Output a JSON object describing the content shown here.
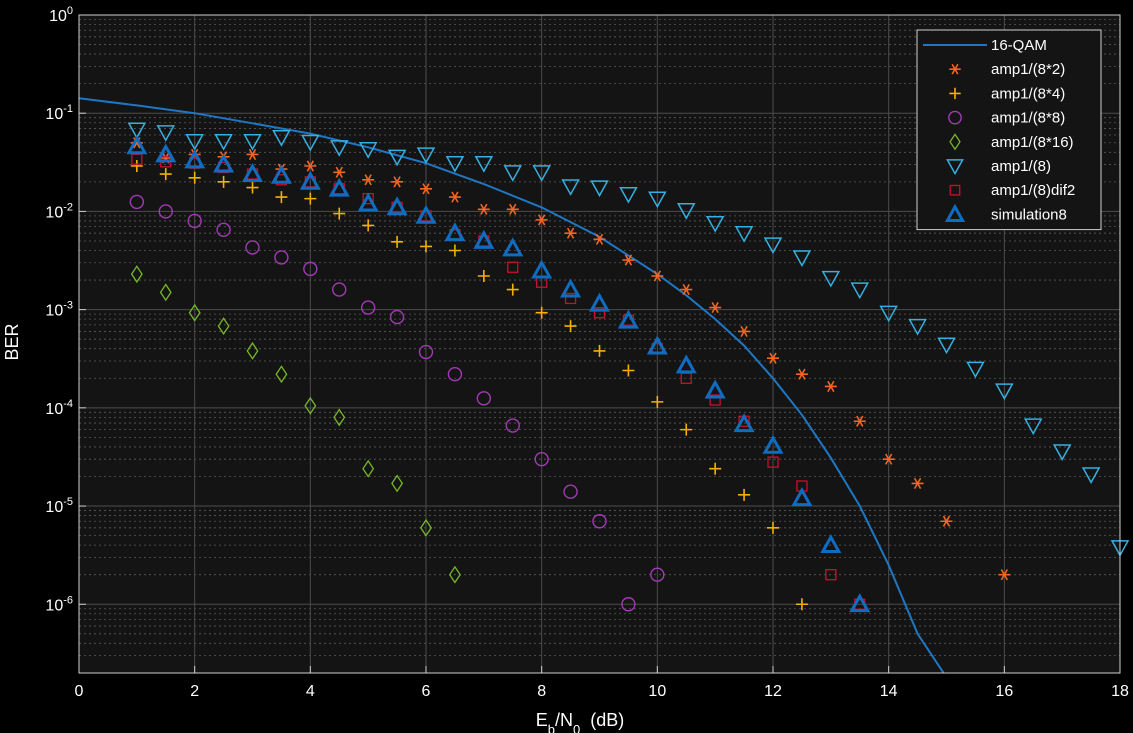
{
  "chart_data": {
    "type": "scatter",
    "xlabel": {
      "base": "E",
      "sub1": "b",
      "mid": "/N",
      "sub2": "0",
      "unit": "  (dB)"
    },
    "ylabel": "BER",
    "xlim": [
      0,
      18
    ],
    "ylim_log10": [
      -6.7,
      0
    ],
    "yscale": "log",
    "grid": true,
    "minor_grid": true,
    "legend_position": "top-right",
    "x_ticks": [
      0,
      2,
      4,
      6,
      8,
      10,
      12,
      14,
      16,
      18
    ],
    "y_ticks": [
      {
        "base": "10",
        "exp": "0",
        "value": 1
      },
      {
        "base": "10",
        "exp": "-1",
        "value": 0.1
      },
      {
        "base": "10",
        "exp": "-2",
        "value": 0.01
      },
      {
        "base": "10",
        "exp": "-3",
        "value": 0.001
      },
      {
        "base": "10",
        "exp": "-4",
        "value": 0.0001
      },
      {
        "base": "10",
        "exp": "-5",
        "value": 1e-05
      },
      {
        "base": "10",
        "exp": "-6",
        "value": 1e-06
      }
    ],
    "series": [
      {
        "name": "16-QAM",
        "style": "line",
        "color": "#1f77c4",
        "x": [
          0,
          1,
          2,
          3,
          4,
          5,
          6,
          7,
          8,
          9,
          10,
          10.5,
          11,
          11.5,
          12,
          12.5,
          13,
          13.5,
          14,
          14.5,
          15
        ],
        "y": [
          0.142,
          0.12,
          0.1,
          0.079,
          0.062,
          0.045,
          0.031,
          0.019,
          0.011,
          0.0055,
          0.0023,
          0.0014,
          0.0008,
          0.00043,
          0.0002,
          8.5e-05,
          3.1e-05,
          1e-05,
          2.5e-06,
          5e-07,
          1.8e-07
        ]
      },
      {
        "name": "amp1/(8*2)",
        "style": "marker",
        "marker": "asterisk",
        "color": "#f26522",
        "x": [
          1,
          1.5,
          2,
          2.5,
          3,
          3.5,
          4,
          4.5,
          5,
          5.5,
          6,
          6.5,
          7,
          7.5,
          8,
          8.5,
          9,
          9.5,
          10,
          10.5,
          11,
          11.5,
          12,
          12.5,
          13,
          13.5,
          14,
          14.5,
          15,
          16
        ],
        "y": [
          0.05,
          0.035,
          0.038,
          0.036,
          0.038,
          0.027,
          0.029,
          0.025,
          0.021,
          0.02,
          0.017,
          0.014,
          0.0105,
          0.0105,
          0.0082,
          0.006,
          0.0052,
          0.0032,
          0.0022,
          0.0016,
          0.00105,
          0.0006,
          0.00032,
          0.00022,
          0.000165,
          7.3e-05,
          3e-05,
          1.7e-05,
          7e-06,
          2e-06
        ]
      },
      {
        "name": "amp1/(8*4)",
        "style": "marker",
        "marker": "plus",
        "color": "#f5b000",
        "x": [
          1,
          1.5,
          2,
          2.5,
          3,
          3.5,
          4,
          4.5,
          5,
          5.5,
          6,
          6.5,
          7,
          7.5,
          8,
          8.5,
          9,
          9.5,
          10,
          10.5,
          11,
          11.5,
          12,
          12.5
        ],
        "y": [
          0.029,
          0.024,
          0.022,
          0.02,
          0.0175,
          0.014,
          0.0135,
          0.0095,
          0.0072,
          0.0049,
          0.0044,
          0.004,
          0.0022,
          0.0016,
          0.00093,
          0.00068,
          0.00038,
          0.00024,
          0.000115,
          6e-05,
          2.4e-05,
          1.3e-05,
          6e-06,
          1e-06
        ]
      },
      {
        "name": "amp1/(8*8)",
        "style": "marker",
        "marker": "circle",
        "color": "#a23ab5",
        "x": [
          1,
          1.5,
          2,
          2.5,
          3,
          3.5,
          4,
          4.5,
          5,
          5.5,
          6,
          6.5,
          7,
          7.5,
          8,
          8.5,
          9,
          9.5,
          10
        ],
        "y": [
          0.0125,
          0.01,
          0.008,
          0.0065,
          0.0043,
          0.0034,
          0.0026,
          0.0016,
          0.00105,
          0.00084,
          0.00037,
          0.00022,
          0.000125,
          6.6e-05,
          3e-05,
          1.4e-05,
          7e-06,
          1e-06,
          2e-06
        ]
      },
      {
        "name": "amp1/(8*16)",
        "style": "marker",
        "marker": "diamond",
        "color": "#76b82a",
        "x": [
          1,
          1.5,
          2,
          2.5,
          3,
          3.5,
          4,
          4.5,
          5,
          5.5,
          6,
          6.5
        ],
        "y": [
          0.0023,
          0.0015,
          0.00093,
          0.00068,
          0.00038,
          0.00022,
          0.000105,
          8e-05,
          2.4e-05,
          1.7e-05,
          6e-06,
          2e-06
        ]
      },
      {
        "name": "amp1/(8)",
        "style": "marker",
        "marker": "triangle-down",
        "color": "#35b0e0",
        "x": [
          1,
          1.5,
          2,
          2.5,
          3,
          3.5,
          4,
          4.5,
          5,
          5.5,
          6,
          6.5,
          7,
          7.5,
          8,
          8.5,
          9,
          9.5,
          10,
          10.5,
          11,
          11.5,
          12,
          12.5,
          13,
          13.5,
          14,
          14.5,
          15,
          15.5,
          16,
          16.5,
          17,
          17.5,
          18
        ],
        "y": [
          0.068,
          0.064,
          0.052,
          0.052,
          0.052,
          0.057,
          0.051,
          0.045,
          0.043,
          0.036,
          0.038,
          0.031,
          0.031,
          0.025,
          0.025,
          0.018,
          0.0175,
          0.015,
          0.0135,
          0.0103,
          0.0076,
          0.006,
          0.0046,
          0.0034,
          0.0021,
          0.0016,
          0.00093,
          0.00068,
          0.00044,
          0.00025,
          0.00015,
          6.6e-05,
          3.6e-05,
          2.1e-05,
          3.8e-06
        ]
      },
      {
        "name": "amp1/(8)dif2",
        "style": "marker",
        "marker": "square",
        "color": "#c8102e",
        "x": [
          1,
          1.5,
          2,
          2.5,
          3,
          3.5,
          4,
          4.5,
          5,
          5.5,
          6,
          6.5,
          7,
          7.5,
          8,
          8.5,
          9,
          9.5,
          10,
          10.5,
          11,
          11.5,
          12,
          12.5,
          13,
          13.5
        ],
        "y": [
          0.034,
          0.032,
          0.031,
          0.028,
          0.024,
          0.021,
          0.02,
          0.017,
          0.0135,
          0.011,
          0.009,
          0.0058,
          0.005,
          0.0027,
          0.0019,
          0.0013,
          0.00093,
          0.00078,
          0.0004,
          0.0002,
          0.00012,
          7.3e-05,
          2.8e-05,
          1.6e-05,
          2e-06,
          1e-06
        ]
      },
      {
        "name": "simulation8",
        "style": "marker",
        "marker": "triangle-up",
        "color": "#0f6cc0",
        "x": [
          1,
          1.5,
          2,
          2.5,
          3,
          3.5,
          4,
          4.5,
          5,
          5.5,
          6,
          6.5,
          7,
          7.5,
          8,
          8.5,
          9,
          9.5,
          10,
          10.5,
          11,
          11.5,
          12,
          12.5,
          13,
          13.5
        ],
        "y": [
          0.046,
          0.038,
          0.033,
          0.03,
          0.024,
          0.023,
          0.02,
          0.017,
          0.012,
          0.011,
          0.009,
          0.006,
          0.005,
          0.0042,
          0.0025,
          0.0016,
          0.00115,
          0.00077,
          0.00042,
          0.00027,
          0.00015,
          6.8e-05,
          4.1e-05,
          1.2e-05,
          4e-06,
          1e-06
        ]
      }
    ]
  }
}
